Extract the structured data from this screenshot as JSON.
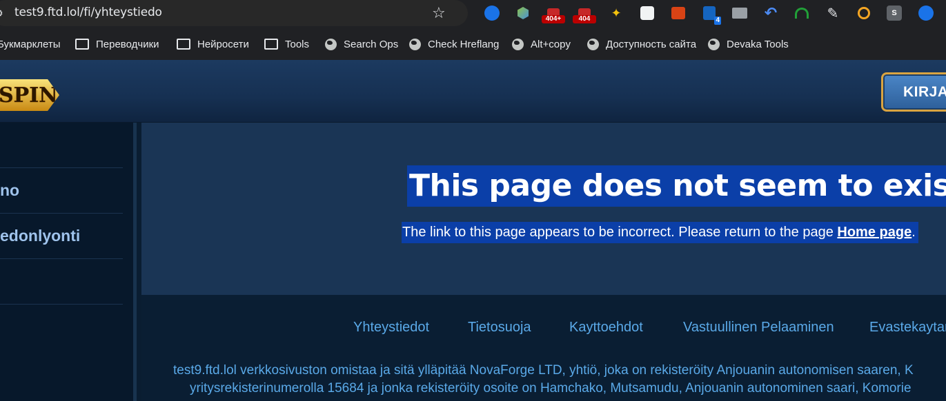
{
  "browser": {
    "url": "test9.ftd.lol/fi/yhteystiedo",
    "extensions": [
      {
        "name": "seo-ext-blue-icon",
        "badge": ""
      },
      {
        "name": "cube-ext-icon",
        "badge": ""
      },
      {
        "name": "broken-link-ext-icon",
        "badge": "404+"
      },
      {
        "name": "broken-link-404-ext-icon",
        "badge": "404"
      },
      {
        "name": "magic-wand-ext-icon",
        "badge": ""
      },
      {
        "name": "robot-ext-icon",
        "badge": ""
      },
      {
        "name": "toggle-ext-icon",
        "badge": ""
      },
      {
        "name": "shield-ext-icon",
        "badge": "4"
      },
      {
        "name": "mail-ext-icon",
        "badge": ""
      },
      {
        "name": "undo-ext-icon",
        "badge": ""
      },
      {
        "name": "headphones-ext-icon",
        "badge": ""
      },
      {
        "name": "eyedropper-ext-icon",
        "badge": ""
      },
      {
        "name": "search-ext-icon",
        "badge": ""
      },
      {
        "name": "s-ext-icon",
        "badge": "S"
      },
      {
        "name": "seo-ext-blue-icon-2",
        "badge": ""
      }
    ],
    "bookmarks": [
      {
        "label": "Букмарклеты",
        "icon": "none"
      },
      {
        "label": "Переводчики",
        "icon": "folder"
      },
      {
        "label": "Нейросети",
        "icon": "folder"
      },
      {
        "label": "Tools",
        "icon": "folder"
      },
      {
        "label": "Search Ops",
        "icon": "globe"
      },
      {
        "label": "Check Hreflang",
        "icon": "globe"
      },
      {
        "label": "Alt+copy",
        "icon": "globe"
      },
      {
        "label": "Доступность сайта",
        "icon": "globe"
      },
      {
        "label": "Devaka Tools",
        "icon": "globe"
      }
    ]
  },
  "header": {
    "logo_text": "SPIN",
    "login_label": "KIRJA"
  },
  "sidebar": {
    "items": [
      "",
      "no",
      "edonlyonti",
      ""
    ]
  },
  "error": {
    "title": "This page does not seem to exist",
    "message": "The link to this page appears to be incorrect. Please return to the page",
    "link_label": "Home page",
    "period": "."
  },
  "footer": {
    "links": [
      "Yhteystiedot",
      "Tietosuoja",
      "Kayttoehdot",
      "Vastuullinen Pelaaminen",
      "Evastekaytan"
    ],
    "line1": "test9.ftd.lol verkkosivuston omistaa ja sitä ylläpitää NovaForge LTD, yhtiö, joka on rekisteröity Anjouanin autonomisen saaren, K",
    "line2": "yritysrekisterinumerolla 15684 ja jonka rekisteröity osoite on Hamchako, Mutsamudu, Anjouanin autonominen saari, Komorie"
  },
  "colors": {
    "highlight": "#0b3fa8",
    "link": "#5aa9e8",
    "sidebar_text": "#9fc3ec"
  }
}
